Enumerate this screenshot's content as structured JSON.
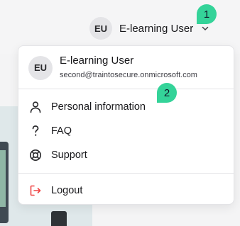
{
  "account": {
    "initials": "EU",
    "name": "E-learning User",
    "email": "second@traintosecure.onmicrosoft.com"
  },
  "badges": {
    "first": "1",
    "second": "2",
    "color": "#34d399"
  },
  "menu": {
    "items": [
      {
        "label": "Personal information",
        "icon": "user-icon"
      },
      {
        "label": "FAQ",
        "icon": "question-icon"
      },
      {
        "label": "Support",
        "icon": "lifebuoy-icon"
      }
    ],
    "logout": {
      "label": "Logout",
      "icon": "logout-icon",
      "color": "#ef4444"
    }
  }
}
